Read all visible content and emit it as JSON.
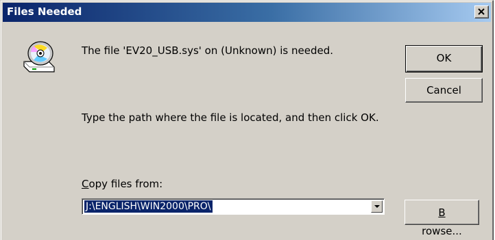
{
  "window": {
    "title": "Files Needed",
    "close_icon": "close-icon"
  },
  "message": {
    "icon": "cd-drive-icon",
    "needed_text": "The file 'EV20_USB.sys' on (Unknown) is needed.",
    "instruction_text": "Type the path where the file is located, and then click OK."
  },
  "buttons": {
    "ok_label": "OK",
    "cancel_label": "Cancel",
    "browse_label_prefix": "B",
    "browse_label_rest": "rowse..."
  },
  "copy_from": {
    "label_prefix": "C",
    "label_rest": "opy files from:",
    "value": "J:\\ENGLISH\\WIN2000\\PRO\\"
  },
  "colors": {
    "dialog_background": "#d4d0c8",
    "title_gradient_start": "#0a246a",
    "title_gradient_end": "#a6caf0",
    "selection_background": "#0a246a"
  }
}
